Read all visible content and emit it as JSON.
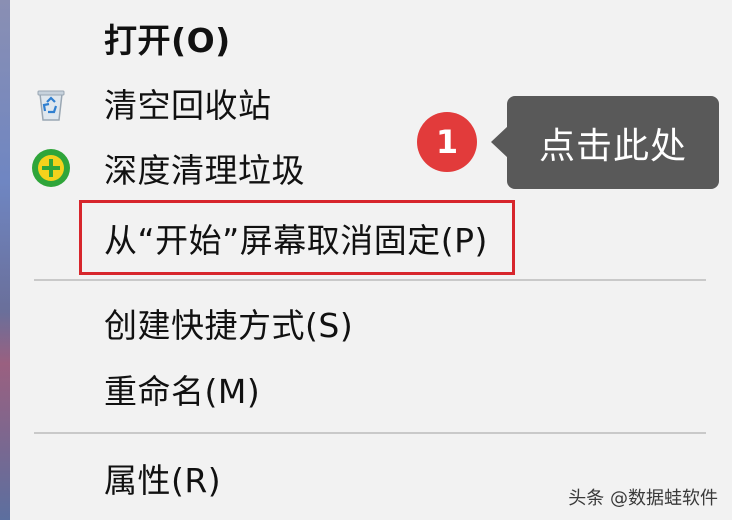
{
  "context_menu": {
    "items": [
      {
        "label": "打开(O)",
        "icon": "",
        "bold": true
      },
      {
        "label": "清空回收站",
        "icon": "recycle-bin-icon"
      },
      {
        "label": "深度清理垃圾",
        "icon": "deep-clean-plus-icon"
      },
      {
        "label": "从“开始”屏幕取消固定(P)",
        "icon": ""
      },
      {
        "label": "创建快捷方式(S)",
        "icon": ""
      },
      {
        "label": "重命名(M)",
        "icon": ""
      },
      {
        "label": "属性(R)",
        "icon": ""
      }
    ]
  },
  "annotation": {
    "step_number": "1",
    "callout_text": "点击此处",
    "highlight_color": "#d7262c",
    "badge_color": "#e23b3b",
    "callout_color": "#595959"
  },
  "watermark": {
    "text": "头条 @数据蛙软件"
  }
}
